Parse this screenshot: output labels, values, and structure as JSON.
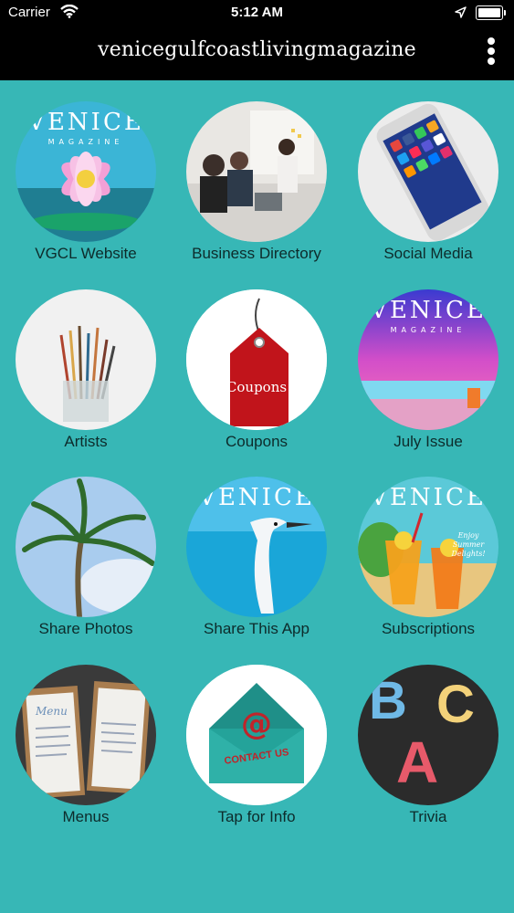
{
  "status_bar": {
    "carrier": "Carrier",
    "time": "5:12 AM"
  },
  "header": {
    "title": "venicegulfcoastlivingmagazine"
  },
  "tiles": [
    {
      "label": "VGCL Website",
      "image_text": "VENICE",
      "image_subtext": "MAGAZINE"
    },
    {
      "label": "Business Directory"
    },
    {
      "label": "Social Media"
    },
    {
      "label": "Artists"
    },
    {
      "label": "Coupons",
      "image_text": "Coupons"
    },
    {
      "label": "July Issue",
      "image_text": "VENICE",
      "image_subtext": "MAGAZINE"
    },
    {
      "label": "Share Photos"
    },
    {
      "label": "Share This App",
      "image_text": "VENICE"
    },
    {
      "label": "Subscriptions",
      "image_text": "VENICE",
      "image_subtext": "Enjoy Summer Delights!"
    },
    {
      "label": "Menus",
      "image_text": "Menu"
    },
    {
      "label": "Tap for Info",
      "image_text": "CONTACT US"
    },
    {
      "label": "Trivia",
      "image_text": "BCA"
    }
  ],
  "colors": {
    "background": "#37b7b6",
    "bars": "#000000"
  },
  "icons": [
    "wifi-icon",
    "location-arrow-icon",
    "battery-icon",
    "more-vert-icon"
  ]
}
